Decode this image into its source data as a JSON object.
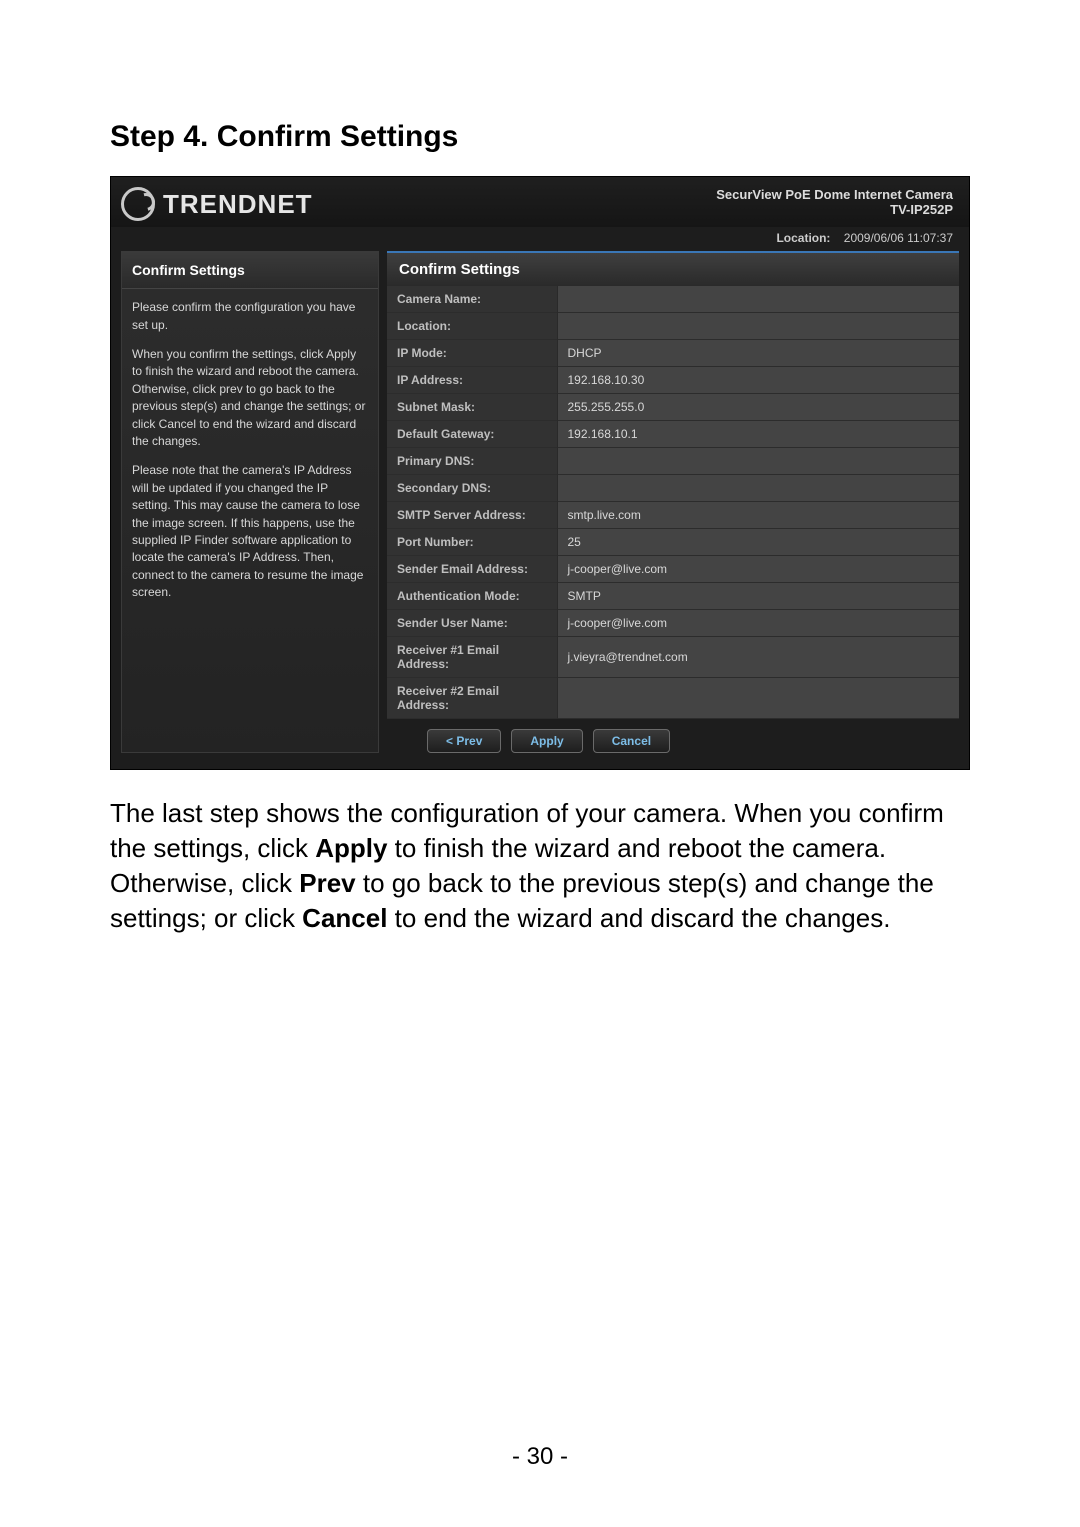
{
  "doc": {
    "step_title": "Step 4. Confirm Settings",
    "description_parts": {
      "p1": "The last step shows the configuration of your camera. When you confirm the settings, click ",
      "b1": "Apply",
      "p2": " to finish the wizard and reboot the camera. Otherwise, click ",
      "b2": "Prev",
      "p3": " to go back to the previous step(s) and change the settings; or click ",
      "b3": "Cancel",
      "p4": " to end the wizard and discard the changes."
    },
    "page_number": "- 30 -"
  },
  "ui": {
    "brand": "TRENDNET",
    "product_title": "SecurView PoE Dome Internet Camera",
    "product_model": "TV-IP252P",
    "location_label": "Location:",
    "location_time": "2009/06/06 11:07:37",
    "sidebar": {
      "title": "Confirm Settings",
      "para1": "Please confirm the configuration you have set up.",
      "para2": "When you confirm the settings, click Apply to finish the wizard and reboot the camera. Otherwise, click prev to go back to the previous step(s) and change the settings; or click Cancel to end the wizard and discard the changes.",
      "para3": "Please note that the camera's IP Address will be updated if you changed the IP setting. This may cause the camera to lose the image screen. If this happens, use the supplied IP Finder software application to locate the camera's IP Address. Then, connect to the camera to resume the image screen."
    },
    "content_title": "Confirm Settings",
    "rows": [
      {
        "label": "Camera Name:",
        "value": ""
      },
      {
        "label": "Location:",
        "value": ""
      },
      {
        "label": "IP Mode:",
        "value": "DHCP"
      },
      {
        "label": "IP Address:",
        "value": "192.168.10.30"
      },
      {
        "label": "Subnet Mask:",
        "value": "255.255.255.0"
      },
      {
        "label": "Default Gateway:",
        "value": "192.168.10.1"
      },
      {
        "label": "Primary DNS:",
        "value": ""
      },
      {
        "label": "Secondary DNS:",
        "value": ""
      },
      {
        "label": "SMTP Server Address:",
        "value": "smtp.live.com"
      },
      {
        "label": "Port Number:",
        "value": "25"
      },
      {
        "label": "Sender Email Address:",
        "value": "j-cooper@live.com"
      },
      {
        "label": "Authentication Mode:",
        "value": "SMTP"
      },
      {
        "label": "Sender User Name:",
        "value": "j-cooper@live.com"
      },
      {
        "label": "Receiver #1 Email Address:",
        "value": "j.vieyra@trendnet.com"
      },
      {
        "label": "Receiver #2 Email Address:",
        "value": ""
      }
    ],
    "buttons": {
      "prev": "< Prev",
      "apply": "Apply",
      "cancel": "Cancel"
    }
  }
}
